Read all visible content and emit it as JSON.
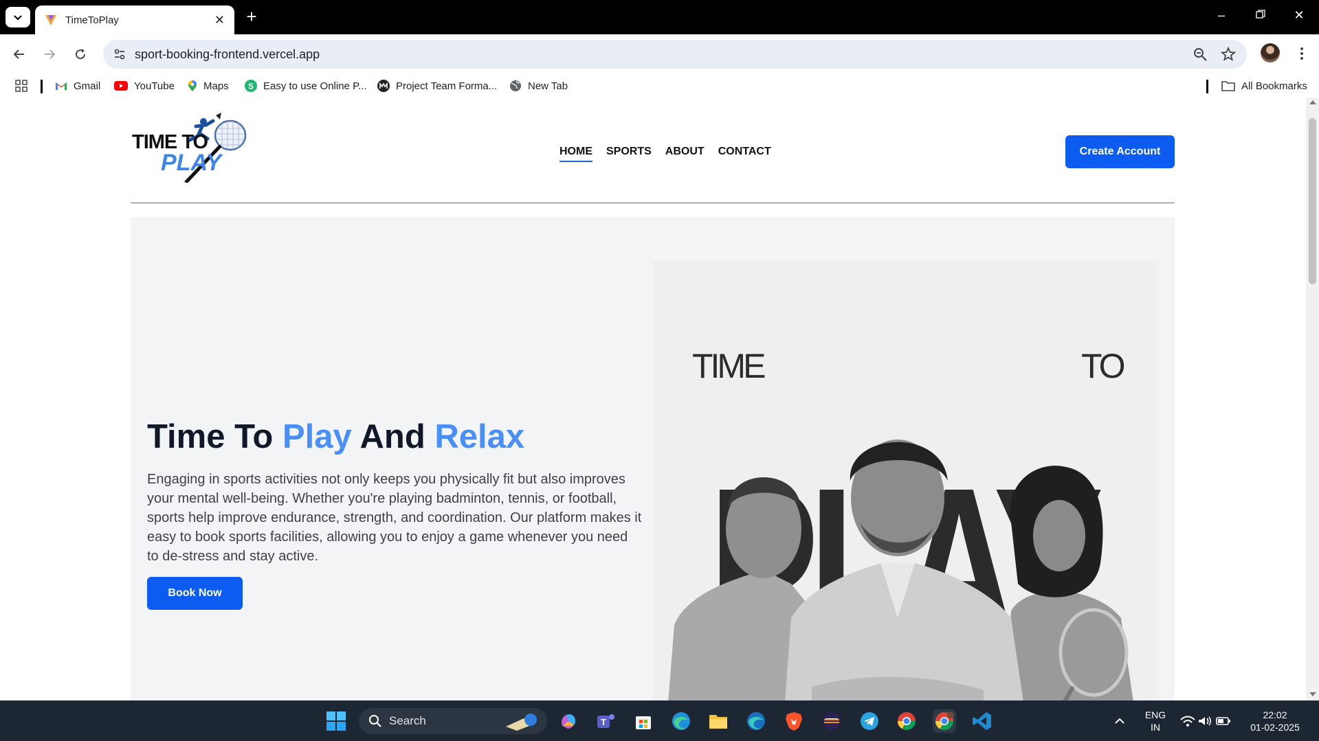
{
  "browser": {
    "tab_title": "TimeToPlay",
    "url": "sport-booking-frontend.vercel.app",
    "bookmarks": [
      {
        "label": "Gmail",
        "icon": "gmail-icon"
      },
      {
        "label": "YouTube",
        "icon": "youtube-icon"
      },
      {
        "label": "Maps",
        "icon": "maps-icon"
      },
      {
        "label": "Easy to use Online P...",
        "icon": "green-s-icon"
      },
      {
        "label": "Project Team Forma...",
        "icon": "m-logo-icon"
      },
      {
        "label": "New Tab",
        "icon": "globe-icon"
      }
    ],
    "all_bookmarks": "All Bookmarks"
  },
  "site": {
    "logo_line1": "TIME TO",
    "logo_line2": "PLAY",
    "nav": [
      "HOME",
      "SPORTS",
      "ABOUT",
      "CONTACT"
    ],
    "active_nav": "HOME",
    "create_account": "Create Account",
    "hero": {
      "title_part1": "Time To ",
      "title_accent1": "Play",
      "title_part2": " And ",
      "title_accent2": "Relax",
      "body": "Engaging in sports activities not only keeps you physically fit but also improves your mental well-being. Whether you're playing badminton, tennis, or football, sports help improve endurance, strength, and coordination. Our platform makes it easy to book sports facilities, allowing you to enjoy a game whenever you need to de-stress and stay active.",
      "book_now": "Book Now",
      "poster_time": "TIME",
      "poster_to": "TO",
      "poster_play": "PLAY"
    }
  },
  "taskbar": {
    "search_label": "Search",
    "lang_line1": "ENG",
    "lang_line2": "IN",
    "time": "22:02",
    "date": "01-02-2025"
  },
  "colors": {
    "primary_button": "#0d5cf2",
    "accent_text": "#4a8ff5",
    "hero_bg": "#f3f4f6"
  }
}
